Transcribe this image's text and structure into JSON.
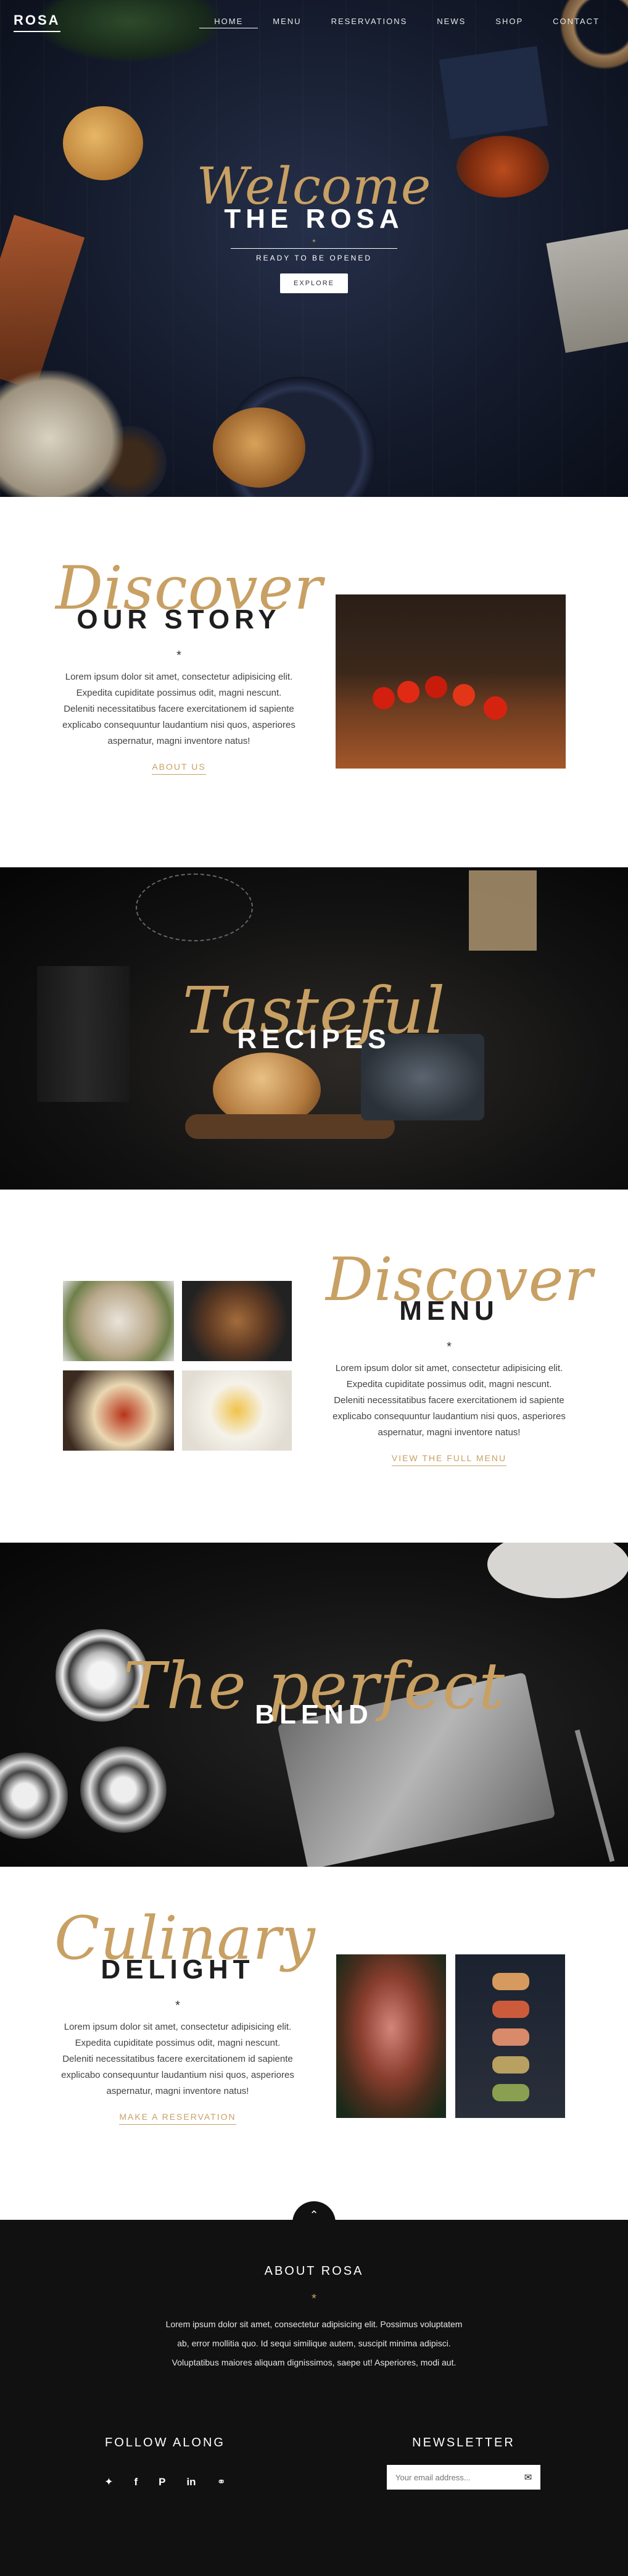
{
  "nav": {
    "logo": "ROSA",
    "items": [
      {
        "label": "HOME"
      },
      {
        "label": "MENU"
      },
      {
        "label": "RESERVATIONS"
      },
      {
        "label": "NEWS"
      },
      {
        "label": "SHOP"
      },
      {
        "label": "CONTACT"
      }
    ]
  },
  "hero": {
    "script": "Welcome",
    "title": "THE ROSA",
    "star": "*",
    "tagline": "READY TO BE OPENED",
    "button": "EXPLORE"
  },
  "story": {
    "script": "Discover",
    "title": "OUR STORY",
    "star": "*",
    "body": "Lorem ipsum dolor sit amet, consectetur adipisicing elit. Expedita cupiditate possimus odit, magni nescunt. Deleniti necessitatibus facere exercitationem id sapiente explicabo consequuntur laudantium nisi quos, asperiores aspernatur, magni inventore natus!",
    "link": "ABOUT US"
  },
  "recipes": {
    "script": "Tasteful",
    "title": "RECIPES"
  },
  "menu": {
    "script": "Discover",
    "title": "MENU",
    "star": "*",
    "body": "Lorem ipsum dolor sit amet, consectetur adipisicing elit. Expedita cupiditate possimus odit, magni nescunt. Deleniti necessitatibus facere exercitationem id sapiente explicabo consequuntur laudantium nisi quos, asperiores aspernatur, magni inventore natus!",
    "link": "VIEW THE FULL MENU"
  },
  "blend": {
    "script": "The perfect",
    "title": "BLEND"
  },
  "culinary": {
    "script": "Culinary",
    "title": "DELIGHT",
    "star": "*",
    "body": "Lorem ipsum dolor sit amet, consectetur adipisicing elit. Expedita cupiditate possimus odit, magni nescunt. Deleniti necessitatibus facere exercitationem id sapiente explicabo consequuntur laudantium nisi quos, asperiores aspernatur, magni inventore natus!",
    "link": "MAKE A RESERVATION"
  },
  "footer": {
    "up_icon": "chevron-up-icon",
    "about_title": "ABOUT ROSA",
    "star": "*",
    "about_body": "Lorem ipsum dolor sit amet, consectetur adipisicing elit. Possimus voluptatem ab, error mollitia quo. Id sequi similique autem, suscipit minima adipisci. Voluptatibus maiores aliquam dignissimos, saepe ut! Asperiores, modi aut.",
    "follow_title": "FOLLOW ALONG",
    "social": [
      "twitter-icon",
      "facebook-icon",
      "pinterest-icon",
      "linkedin-icon",
      "tripadvisor-icon"
    ],
    "newsletter_title": "NEWSLETTER",
    "newsletter_placeholder": "Your email address..."
  },
  "colors": {
    "accent": "#c8a063",
    "footer_bg": "#111111",
    "hero_bg": "#141b2c"
  }
}
